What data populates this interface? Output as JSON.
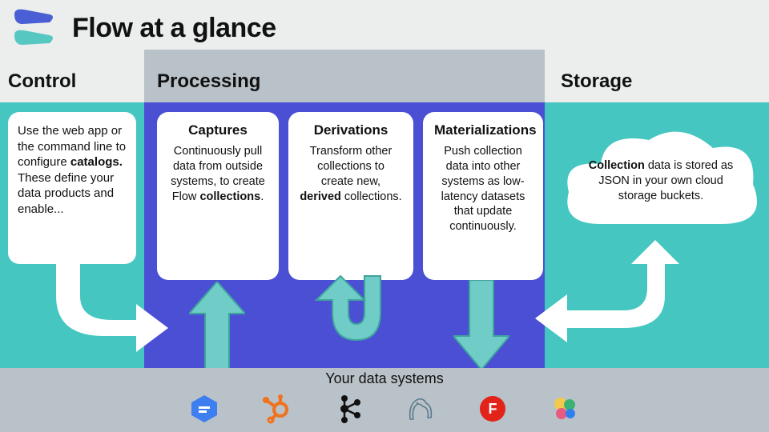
{
  "title": "Flow at a glance",
  "sections": {
    "control": {
      "label": "Control",
      "card": "Use the web app or the command line to configure <b>catalogs.</b> These define your data products and enable..."
    },
    "processing": {
      "label": "Processing",
      "captures": {
        "title": "Captures",
        "body": "Continuously pull data from outside systems, to create Flow <b>collections</b>."
      },
      "derivations": {
        "title": "Derivations",
        "body": "Transform other collections to create new, <b>derived</b> collections."
      },
      "materializations": {
        "title": "Materializations",
        "body": "Push collection data into other systems as low-latency datasets that update continuously."
      }
    },
    "storage": {
      "label": "Storage",
      "cloud": "<b>Collection</b> data is stored as JSON in your own cloud storage buckets."
    }
  },
  "bottom_label": "Your data systems",
  "systems": [
    "bigquery",
    "hubspot",
    "kafka",
    "mysql",
    "fauna",
    "elasticsearch"
  ]
}
